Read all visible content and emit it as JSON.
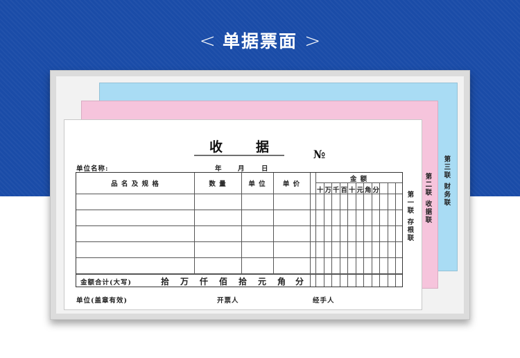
{
  "banner": {
    "title": "单据票面",
    "chevron_left": "<",
    "chevron_right": ">"
  },
  "receipt": {
    "title_chars": [
      "收",
      "据"
    ],
    "number_mark": "№",
    "unit_name_label": "单位名称:",
    "date_year": "年",
    "date_month": "月",
    "date_day": "日",
    "columns": {
      "item": "品 名 及 规 格",
      "quantity": "数 量",
      "unit": "单 位",
      "price": "单 价",
      "amount": "金   额"
    },
    "digits": [
      "十",
      "万",
      "千",
      "百",
      "十",
      "元",
      "角",
      "分"
    ],
    "total_label": "金额合计(大写)",
    "total_units": [
      "拾",
      "万",
      "仟",
      "佰",
      "拾",
      "元",
      "角",
      "分"
    ],
    "footer": {
      "unit_seal": "单位(盖章有效)",
      "issuer": "开票人",
      "handler": "经手人"
    }
  },
  "copies": {
    "first": "第一联 存根联",
    "second": "第二联 收据联",
    "third": "第三联 财务联"
  },
  "colors": {
    "banner": "#1a4ca8",
    "pink_sheet": "#f6c4dc",
    "blue_sheet": "#a9dcf4"
  }
}
